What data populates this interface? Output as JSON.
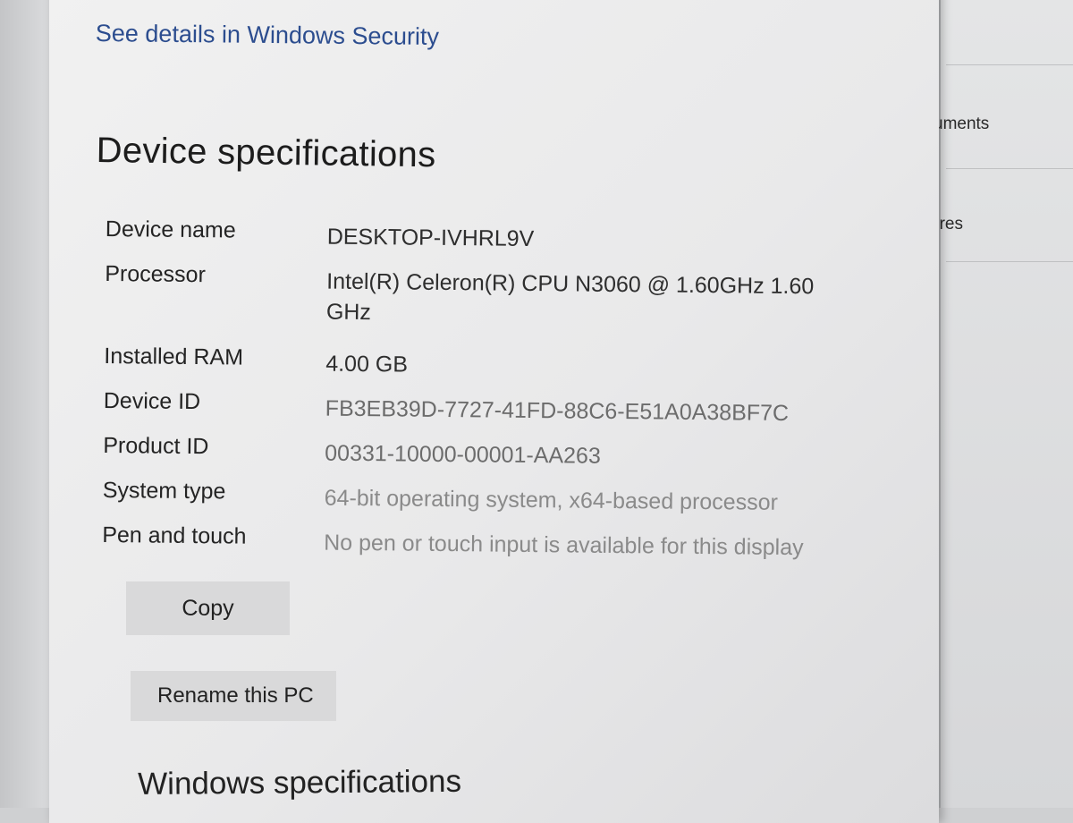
{
  "security": {
    "link_label": "See details in Windows Security"
  },
  "device_specifications": {
    "title": "Device specifications",
    "rows": [
      {
        "label": "Device name",
        "value": "DESKTOP-IVHRL9V"
      },
      {
        "label": "Processor",
        "value": "Intel(R) Celeron(R) CPU  N3060  @ 1.60GHz   1.60 GHz"
      },
      {
        "label": "Installed RAM",
        "value": "4.00 GB"
      },
      {
        "label": "Device ID",
        "value": "FB3EB39D-7727-41FD-88C6-E51A0A38BF7C"
      },
      {
        "label": "Product ID",
        "value": "00331-10000-00001-AA263"
      },
      {
        "label": "System type",
        "value": "64-bit operating system, x64-based processor"
      },
      {
        "label": "Pen and touch",
        "value": "No pen or touch input is available for this display"
      }
    ],
    "copy_label": "Copy",
    "rename_label": "Rename this PC"
  },
  "windows_specifications": {
    "title": "Windows specifications"
  },
  "right_panel": {
    "items": [
      "uments",
      "ures"
    ]
  }
}
